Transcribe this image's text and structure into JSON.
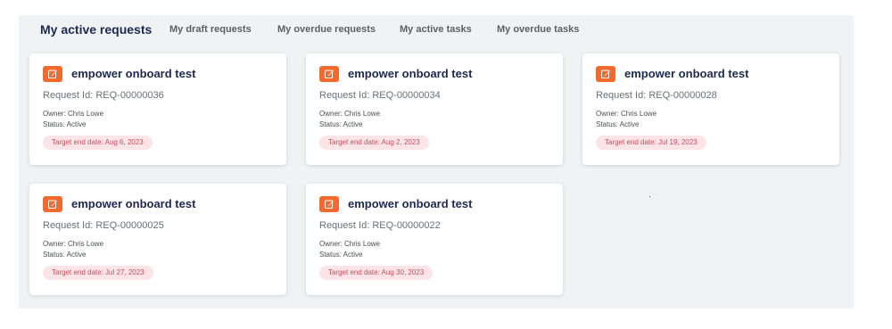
{
  "tabs": [
    {
      "label": "My active requests"
    },
    {
      "label": "My draft requests"
    },
    {
      "label": "My overdue requests"
    },
    {
      "label": "My active tasks"
    },
    {
      "label": "My overdue tasks"
    }
  ],
  "cards": [
    {
      "title": "empower onboard test",
      "request_id": "Request Id: REQ-00000036",
      "owner": "Owner: Chris Lowe",
      "status": "Status: Active",
      "target_date": "Target end date: Aug 6, 2023"
    },
    {
      "title": "empower onboard test",
      "request_id": "Request Id: REQ-00000034",
      "owner": "Owner: Chris Lowe",
      "status": "Status: Active",
      "target_date": "Target end date: Aug 2, 2023"
    },
    {
      "title": "empower onboard test",
      "request_id": "Request Id: REQ-00000028",
      "owner": "Owner: Chris Lowe",
      "status": "Status: Active",
      "target_date": "Target end date: Jul 19, 2023"
    },
    {
      "title": "empower onboard test",
      "request_id": "Request Id: REQ-00000025",
      "owner": "Owner: Chris Lowe",
      "status": "Status: Active",
      "target_date": "Target end date: Jul 27, 2023"
    },
    {
      "title": "empower onboard test",
      "request_id": "Request Id: REQ-00000022",
      "owner": "Owner: Chris Lowe",
      "status": "Status: Active",
      "target_date": "Target end date: Aug 30, 2023"
    }
  ],
  "icons": {
    "card_action": "edit-icon"
  },
  "colors": {
    "accent": "#f26a2e",
    "title": "#1b2a4e",
    "badge_bg": "#fde4e6",
    "badge_text": "#c0505e",
    "panel_bg": "#f1f2f4"
  }
}
